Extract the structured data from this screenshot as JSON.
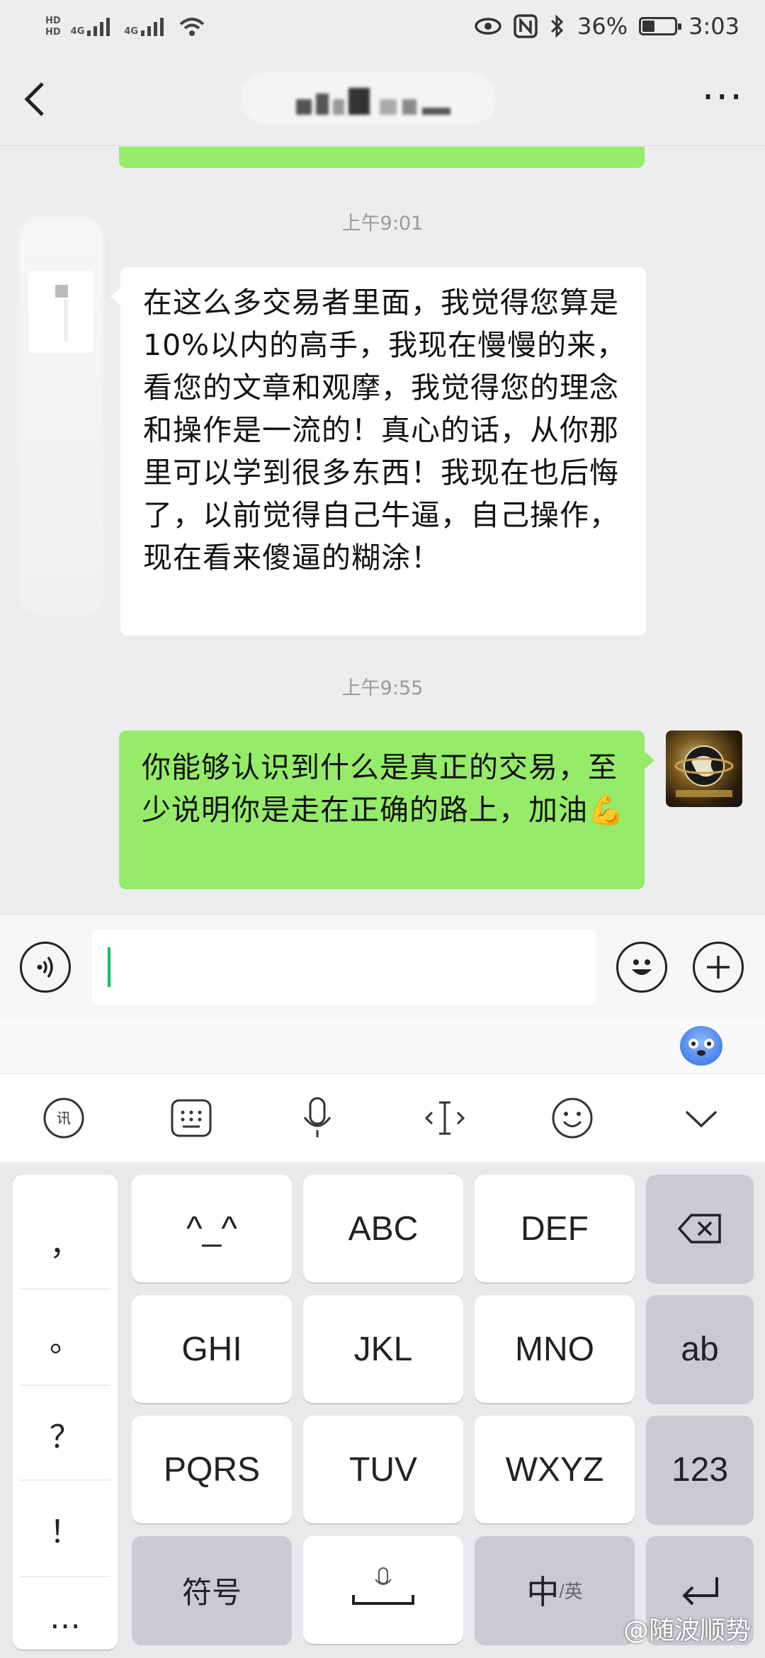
{
  "status_bar": {
    "hd1": "HD",
    "hd2": "HD",
    "net1": "4G",
    "net2": "4G",
    "battery": "36%",
    "time": "3:03"
  },
  "nav": {
    "back_icon": "chevron-left-icon",
    "more_label": "···"
  },
  "chat": {
    "time1": "上午9:01",
    "msg_in": "在这么多交易者里面，我觉得您算是10%以内的高手，我现在慢慢的来，看您的文章和观摩，我觉得您的理念和操作是一流的！真心的话，从你那里可以学到很多东西！我现在也后悔了，以前觉得自己牛逼，自己操作，现在看来傻逼的糊涂！",
    "time2": "上午9:55",
    "msg_out": "你能够认识到什么是真正的交易，至少说明你是走在正确的路上，加油💪"
  },
  "keyboard": {
    "punct": [
      "，",
      "。",
      "？",
      "！",
      "…"
    ],
    "rows": [
      [
        "^_^",
        "ABC",
        "DEF"
      ],
      [
        "GHI",
        "JKL",
        "MNO"
      ],
      [
        "PQRS",
        "TUV",
        "WXYZ"
      ]
    ],
    "ab": "ab",
    "num": "123",
    "symbols": "符号",
    "lang_main": "中",
    "lang_sub": "/英"
  },
  "watermark": "@随波顺势",
  "colors": {
    "bubble_out": "#95ec69",
    "bubble_in": "#ffffff",
    "caret": "#07c160"
  }
}
